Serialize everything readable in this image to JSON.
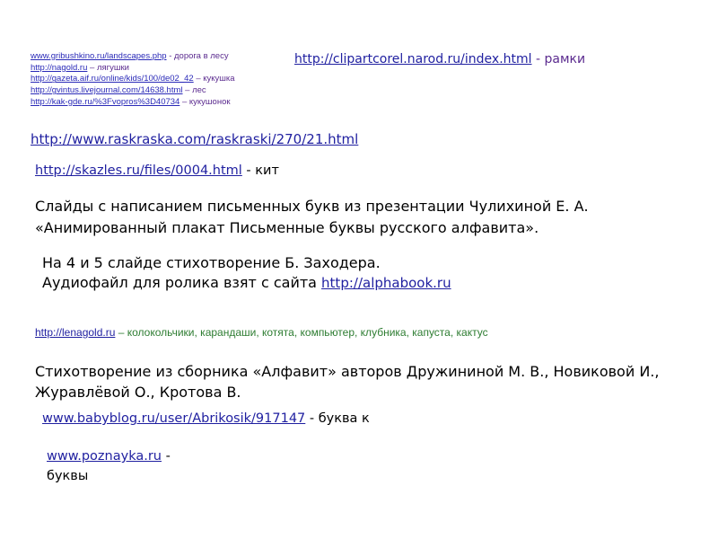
{
  "small_credits": [
    {
      "link": "www.gribushkino.ru/landscapes.php",
      "note": " - дорога в лесу"
    },
    {
      "link": "http://nagold.ru",
      "note": "  – лягушки"
    },
    {
      "link": "http://gazeta.aif.ru/online/kids/100/de02_42",
      "note": "  – кукушка"
    },
    {
      "link": "http://gvintus.livejournal.com/14638.html",
      "note": "  – лес"
    },
    {
      "link": "http://kak-gde.ru/%3Fvopros%3D40734",
      "note": "  – кукушонок"
    }
  ],
  "clipart": {
    "link": "http://clipartcorel.narod.ru/index.html",
    "note": " - рамки"
  },
  "raskraska": {
    "link": "http://www.raskraska.com/raskraski/270/21.html"
  },
  "skazles": {
    "link": "http://skazles.ru/files/0004.html",
    "note": "  - кит"
  },
  "slides_text": {
    "line1": "Слайды с написанием письменных букв из презентации Чулихиной Е. А.",
    "line2": "«Анимированный плакат Письменные буквы русского алфавита»."
  },
  "poem_text": {
    "line1": "На 4 и 5 слайде стихотворение Б. Заходера.",
    "line2_prefix": "Аудиофайл для ролика взят с сайта ",
    "line2_link": "http://alphabook.ru"
  },
  "lenagold": {
    "link": "http://lenagold.ru",
    "note": " – колокольчики, карандаши, котята, компьютер, клубника, капуста, кактус"
  },
  "alphabet_poem": {
    "text": "Стихотворение из сборника «Алфавит» авторов Дружининой М. В., Новиковой И., Журавлёвой О., Кротова В."
  },
  "babyblog": {
    "link": "www.babyblog.ru/user/Abrikosik/917147",
    "note": " - буква к"
  },
  "poznayka": {
    "link": "www.poznayka.ru",
    "note": " -",
    "line2": "буквы"
  }
}
